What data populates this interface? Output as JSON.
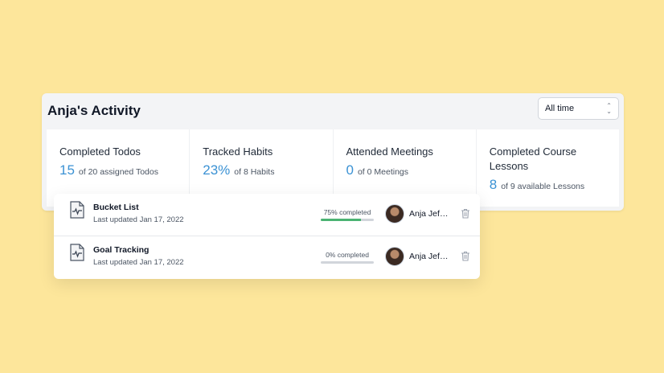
{
  "activity": {
    "title": "Anja's Activity",
    "range_selected": "All time"
  },
  "stats": [
    {
      "label": "Completed Todos",
      "value": "15",
      "sub": "of 20 assigned Todos"
    },
    {
      "label": "Tracked Habits",
      "value": "23%",
      "sub": "of 8 Habits"
    },
    {
      "label": "Attended Meetings",
      "value": "0",
      "sub": "of 0 Meetings"
    },
    {
      "label": "Completed Course Lessons",
      "value": "8",
      "sub": "of 9 available Lessons"
    }
  ],
  "docs": [
    {
      "name": "Bucket List",
      "updated": "Last updated Jan 17, 2022",
      "progress_label": "75% completed",
      "progress": 0.75,
      "owner": "Anja Jef…",
      "icon": "document-icon"
    },
    {
      "name": "Goal Tracking",
      "updated": "Last updated Jan 17, 2022",
      "progress_label": "0% completed",
      "progress": 0,
      "owner": "Anja Jef…",
      "icon": "document-icon"
    }
  ],
  "colors": {
    "background": "#fde69b",
    "accent": "#3b92d4",
    "progress": "#4bb373"
  }
}
